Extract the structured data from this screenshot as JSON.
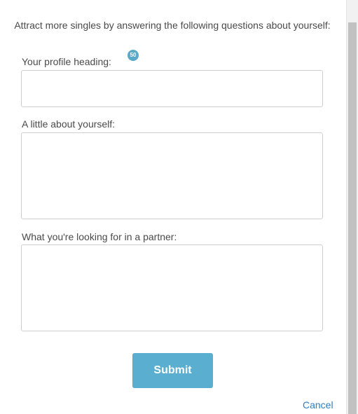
{
  "intro_text": "Attract more singles by answering the following questions about yourself:",
  "fields": [
    {
      "label": "Your profile heading:",
      "value": "",
      "remaining_chars": "50"
    },
    {
      "label": "A little about yourself:",
      "value": ""
    },
    {
      "label": "What you're looking for in a partner:",
      "value": ""
    }
  ],
  "actions": {
    "submit_label": "Submit",
    "cancel_label": "Cancel"
  },
  "colors": {
    "accent": "#5aaecf",
    "badge": "#5aa9c9",
    "link": "#2f7fc1"
  }
}
